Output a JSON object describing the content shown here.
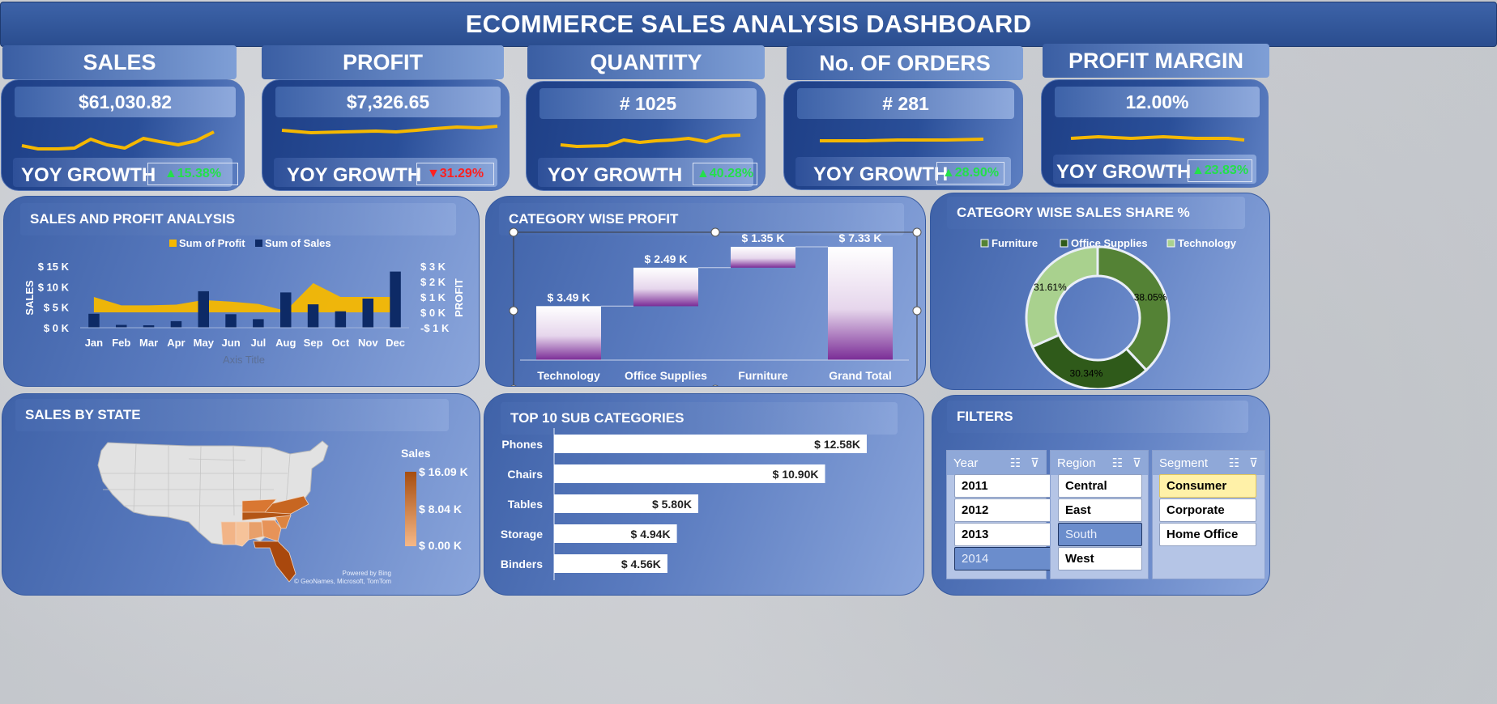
{
  "title": "ECOMMERCE SALES ANALYSIS DASHBOARD",
  "colors": {
    "accent_gold": "#f5b800",
    "navy": "#0d2a66",
    "up": "#23e04a",
    "down": "#ff2020",
    "purple": "#7a2c96",
    "orange_dark": "#a64d0f",
    "orange_light": "#f3b07c"
  },
  "kpis": [
    {
      "title": "SALES",
      "value": "$61,030.82",
      "yoy_label": "YOY GROWTH",
      "growth": "▲15.38%",
      "direction": "up"
    },
    {
      "title": "PROFIT",
      "value": "$7,326.65",
      "yoy_label": "YOY GROWTH",
      "growth": "▼31.29%",
      "direction": "down"
    },
    {
      "title": "QUANTITY",
      "value": "# 1025",
      "yoy_label": "YOY GROWTH",
      "growth": "▲40.28%",
      "direction": "up"
    },
    {
      "title": "No. OF ORDERS",
      "value": "# 281",
      "yoy_label": "YOY GROWTH",
      "growth": "▲28.90%",
      "direction": "up"
    },
    {
      "title": "PROFIT MARGIN",
      "value": "12.00%",
      "yoy_label": "YOY GROWTH",
      "growth": "▲23.83%",
      "direction": "up"
    }
  ],
  "sales_profit": {
    "title": "SALES AND PROFIT ANALYSIS",
    "legend": [
      "Sum of Profit",
      "Sum of Sales"
    ],
    "ylabel_left": "SALES",
    "ylabel_right": "PROFIT",
    "xlabel": "Axis Title",
    "left_ticks": [
      "$ 15 K",
      "$ 10 K",
      "$ 5 K",
      "$ 0 K"
    ],
    "right_ticks": [
      "$ 3 K",
      "$ 2 K",
      "$ 1 K",
      "$ 0 K",
      "-$ 1 K"
    ]
  },
  "category_profit": {
    "title": "CATEGORY WISE PROFIT",
    "categories": [
      "Technology",
      "Office Supplies",
      "Furniture",
      "Grand Total"
    ],
    "labels": [
      "$ 3.49 K",
      "$ 2.49 K",
      "$ 1.35 K",
      "$ 7.33 K"
    ]
  },
  "sales_share": {
    "title": "CATEGORY WISE SALES SHARE %",
    "legend": [
      "Furniture",
      "Office Supplies",
      "Technology"
    ],
    "labels": [
      "38.05%",
      "30.34%",
      "31.61%"
    ]
  },
  "state_map": {
    "title": "SALES BY STATE",
    "legend_title": "Sales",
    "legend_ticks": [
      "$ 16.09 K",
      "$ 8.04 K",
      "$ 0.00 K"
    ],
    "credit1": "Powered by Bing",
    "credit2": "© GeoNames, Microsoft, TomTom"
  },
  "subcategories": {
    "title": "TOP 10 SUB CATEGORIES",
    "names": [
      "Phones",
      "Chairs",
      "Tables",
      "Storage",
      "Binders"
    ],
    "labels": [
      "$ 12.58K",
      "$ 10.90K",
      "$ 5.80K",
      "$ 4.94K",
      "$ 4.56K"
    ]
  },
  "filters": {
    "title": "FILTERS",
    "year": {
      "header": "Year",
      "items": [
        "2011",
        "2012",
        "2013",
        "2014"
      ]
    },
    "region": {
      "header": "Region",
      "items": [
        "Central",
        "East",
        "South",
        "West"
      ]
    },
    "segment": {
      "header": "Segment",
      "items": [
        "Consumer",
        "Corporate",
        "Home Office"
      ]
    }
  },
  "chart_data": [
    {
      "type": "bar",
      "title": "SALES AND PROFIT ANALYSIS",
      "xlabel": "Axis Title",
      "ylabel": "SALES",
      "y2label": "PROFIT",
      "categories": [
        "Jan",
        "Feb",
        "Mar",
        "Apr",
        "May",
        "Jun",
        "Jul",
        "Aug",
        "Sep",
        "Oct",
        "Nov",
        "Dec"
      ],
      "ylim": [
        0,
        15000
      ],
      "y2lim": [
        -1000,
        3000
      ],
      "series": [
        {
          "name": "Sum of Sales",
          "chart": "bar",
          "axis": "left",
          "values": [
            3400,
            700,
            600,
            1600,
            8900,
            3300,
            2100,
            8600,
            5700,
            4000,
            7100,
            13700
          ]
        },
        {
          "name": "Sum of Profit",
          "chart": "area",
          "axis": "right",
          "values": [
            1000,
            450,
            450,
            500,
            800,
            700,
            550,
            100,
            1900,
            1000,
            1000,
            1000
          ]
        }
      ]
    },
    {
      "type": "bar",
      "title": "CATEGORY WISE PROFIT",
      "categories": [
        "Technology",
        "Office Supplies",
        "Furniture",
        "Grand Total"
      ],
      "values": [
        3.49,
        2.49,
        1.35,
        7.33
      ]
    },
    {
      "type": "pie",
      "title": "CATEGORY WISE SALES SHARE %",
      "categories": [
        "Office Supplies",
        "Furniture",
        "Technology"
      ],
      "values": [
        38.05,
        30.34,
        31.61
      ]
    },
    {
      "type": "bar",
      "title": "TOP 10 SUB CATEGORIES",
      "categories": [
        "Phones",
        "Chairs",
        "Tables",
        "Storage",
        "Binders"
      ],
      "values": [
        12.58,
        10.9,
        5.8,
        4.94,
        4.56
      ]
    }
  ]
}
